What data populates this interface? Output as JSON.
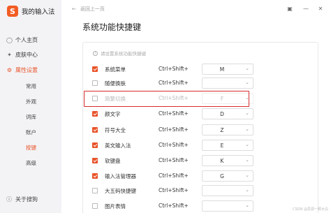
{
  "app": {
    "name": "我的输入法",
    "logo": "S"
  },
  "topbar": {
    "back_label": "返回上一页",
    "back_icon": "arrow-left-icon"
  },
  "sidebar": {
    "items": [
      {
        "label": "个人主页",
        "icon": "user-icon",
        "active": false
      },
      {
        "label": "皮肤中心",
        "icon": "palette-icon",
        "active": false
      },
      {
        "label": "属性设置",
        "icon": "settings-icon",
        "active": true
      }
    ],
    "sub_items": [
      {
        "label": "常用",
        "active": false
      },
      {
        "label": "外观",
        "active": false
      },
      {
        "label": "词库",
        "active": false
      },
      {
        "label": "账户",
        "active": false
      },
      {
        "label": "按键",
        "active": true
      },
      {
        "label": "高级",
        "active": false
      }
    ],
    "about": {
      "label": "关于搜狗",
      "icon": "info-icon"
    }
  },
  "page": {
    "title": "系统功能快捷键",
    "hint": "请设置系统功能快捷键"
  },
  "shortcuts": [
    {
      "checked": true,
      "name": "系统菜单",
      "combo": "Ctrl+Shift+",
      "key": "M"
    },
    {
      "checked": false,
      "name": "随便换肤",
      "combo": "Ctrl+Shift+",
      "key": "",
      "disabled_key": true
    },
    {
      "checked": false,
      "name": "简繁切换",
      "combo": "Ctrl+Shift+",
      "key": "F",
      "disabled": true
    },
    {
      "checked": true,
      "name": "颜文字",
      "combo": "Ctrl+Shift+",
      "key": "D"
    },
    {
      "checked": true,
      "name": "符号大全",
      "combo": "Ctrl+Shift+",
      "key": "Z"
    },
    {
      "checked": true,
      "name": "英文输入法",
      "combo": "Ctrl+Shift+",
      "key": "E"
    },
    {
      "checked": true,
      "name": "软键盘",
      "combo": "Ctrl+Shift+",
      "key": "K"
    },
    {
      "checked": true,
      "name": "输入法管理器",
      "combo": "Ctrl+Shift+",
      "key": "G"
    },
    {
      "checked": false,
      "name": "大五码快捷键",
      "combo": "Ctrl+Shift+",
      "key": ""
    },
    {
      "checked": false,
      "name": "图片表情",
      "combo": "Ctrl+Shift+",
      "key": ""
    }
  ],
  "watermark": "CSDN @思源一颗大白",
  "colors": {
    "accent": "#e8542a",
    "highlight": "#d62a2a"
  }
}
